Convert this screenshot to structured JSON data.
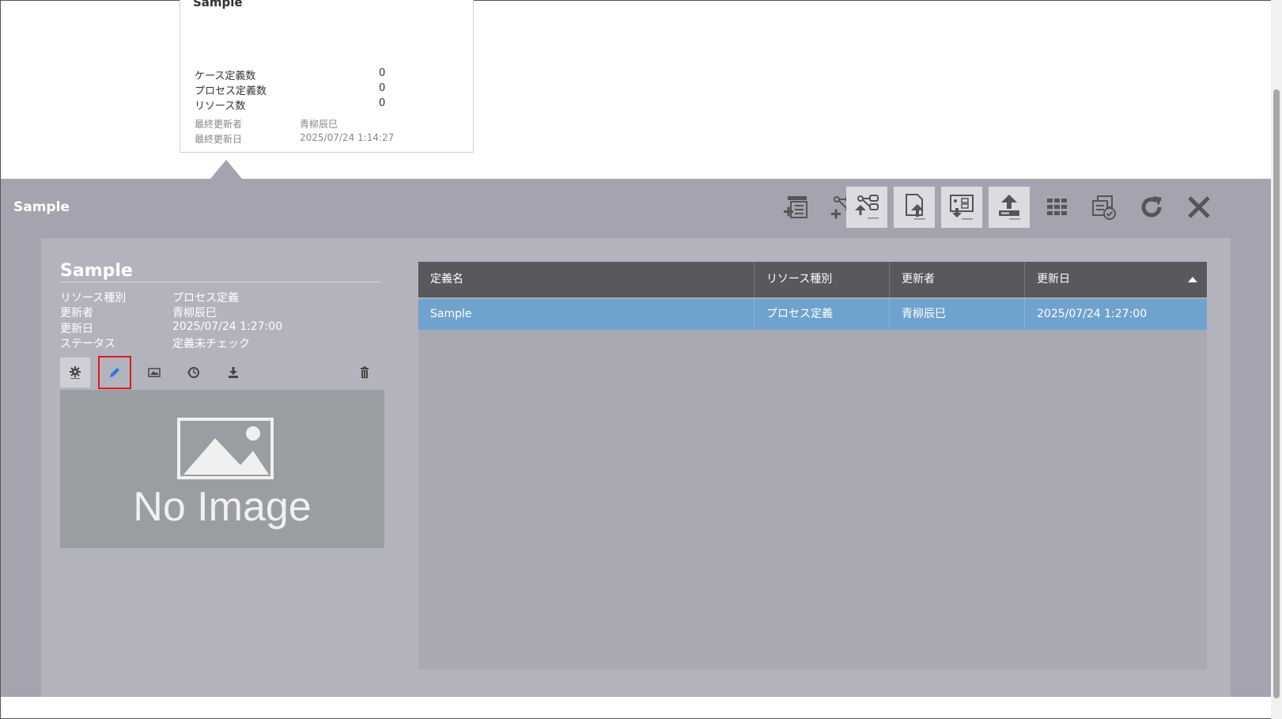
{
  "card": {
    "title": "Sample",
    "rows": [
      {
        "label": "ケース定義数",
        "value": "0"
      },
      {
        "label": "プロセス定義数",
        "value": "0"
      },
      {
        "label": "リソース数",
        "value": "0"
      }
    ],
    "meta": [
      {
        "label": "最終更新者",
        "value": "青柳辰巳"
      },
      {
        "label": "最終更新日",
        "value": "2025/07/24 1:14:27"
      }
    ]
  },
  "header": {
    "title": "Sample",
    "toolbar_icons": [
      "add-definition-icon",
      "add-process-icon",
      "upload-process-icon",
      "upload-file-icon",
      "download-diagram-icon",
      "upload-icon",
      "grid-icon",
      "check-resources-icon",
      "refresh-icon",
      "close-icon"
    ]
  },
  "detail": {
    "title": "Sample",
    "fields": [
      {
        "label": "リソース種別",
        "value": "プロセス定義"
      },
      {
        "label": "更新者",
        "value": "青柳辰巳"
      },
      {
        "label": "更新日",
        "value": "2025/07/24 1:27:00"
      },
      {
        "label": "ステータス",
        "value": "定義未チェック"
      }
    ],
    "image_placeholder": "No Image"
  },
  "table": {
    "columns": [
      "定義名",
      "リソース種別",
      "更新者",
      "更新日"
    ],
    "rows": [
      [
        "Sample",
        "プロセス定義",
        "青柳辰巳",
        "2025/07/24 1:27:00"
      ]
    ],
    "sort_column": "更新日",
    "sort_direction": "ascending"
  },
  "colors": {
    "panel": "#a4a4b0",
    "selected_row": "#6fa3cd",
    "table_header": "#58595d",
    "highlight": "#e01818"
  }
}
